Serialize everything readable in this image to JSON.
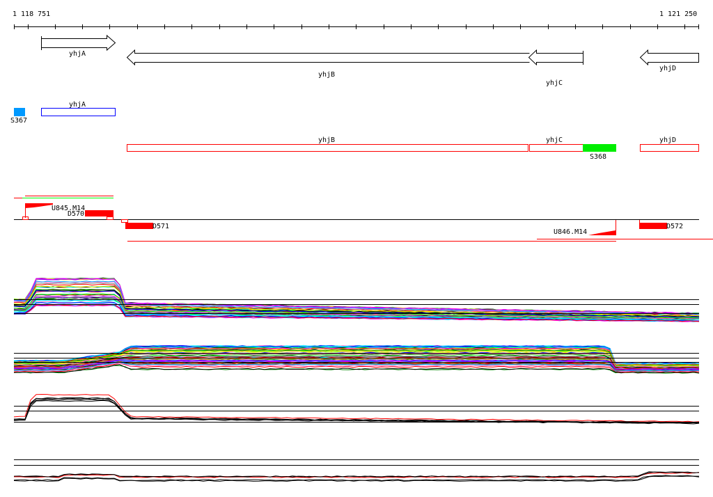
{
  "ruler": {
    "start_label": "1 118 751",
    "end_label": "1 121 250"
  },
  "genes_track": [
    {
      "name": "yhjA",
      "strand": "+"
    },
    {
      "name": "yhjB",
      "strand": "-"
    },
    {
      "name": "yhjC",
      "strand": "-"
    },
    {
      "name": "yhjD",
      "strand": "-"
    }
  ],
  "annotation_track": {
    "plus": [
      {
        "label": "S367",
        "color": "#0099ff"
      },
      {
        "label": "yhjA",
        "color": "#0000ff"
      }
    ],
    "minus": [
      {
        "label": "yhjB",
        "color": "#ff0000"
      },
      {
        "label": "yhjC",
        "color": "#ff0000"
      },
      {
        "label": "S368",
        "color": "#00ee00"
      },
      {
        "label": "yhjD",
        "color": "#ff0000"
      }
    ]
  },
  "segments_track": {
    "labels": [
      "U845.M14",
      "D570",
      "D571",
      "U846.M14",
      "D572"
    ],
    "color": "#ff0000"
  }
}
